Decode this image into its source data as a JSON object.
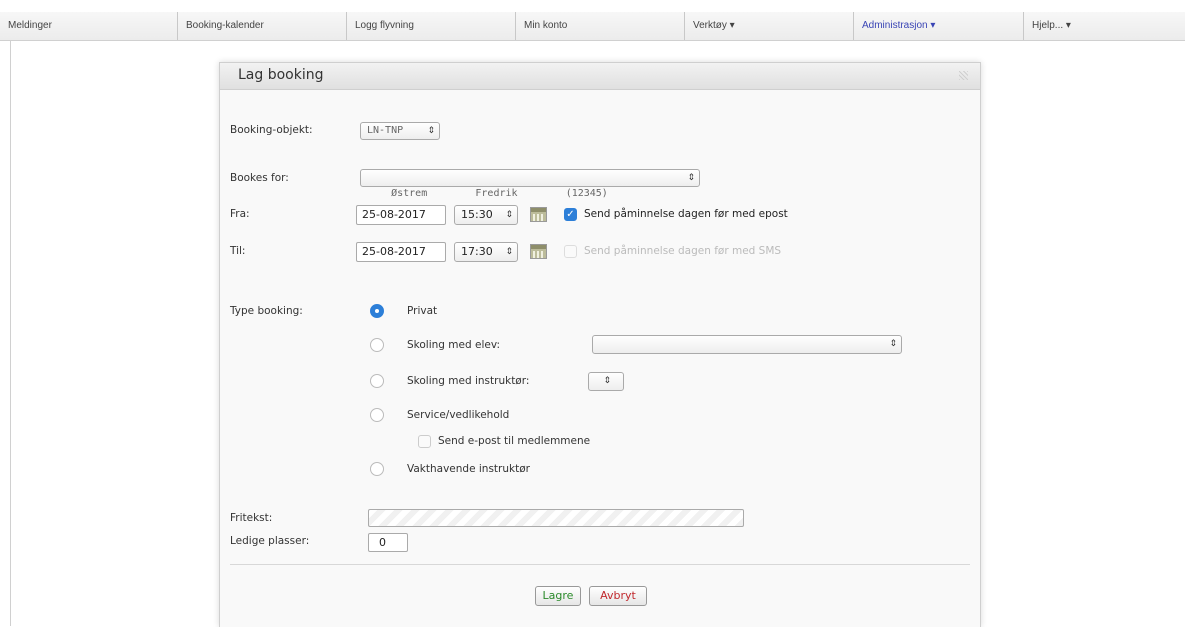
{
  "nav": [
    {
      "label": "Meldinger"
    },
    {
      "label": "Booking-kalender"
    },
    {
      "label": "Logg flyvning"
    },
    {
      "label": "Min konto"
    },
    {
      "label": "Verktøy ▾"
    },
    {
      "label": "Administrasjon ▾"
    },
    {
      "label": "Hjelp... ▾"
    }
  ],
  "dialog": {
    "title": "Lag booking",
    "booking_object_label": "Booking-objekt:",
    "booking_object_value": "LN-TNP",
    "booked_for_label": "Bookes for:",
    "booked_for_value": "Østrem        Fredrik        (12345)",
    "from_label": "Fra:",
    "from_date": "25-08-2017",
    "from_time": "15:30",
    "to_label": "Til:",
    "to_date": "25-08-2017",
    "to_time": "17:30",
    "remind_email_label": "Send påminnelse dagen før med epost",
    "remind_sms_label": "Send påminnelse dagen før med SMS",
    "type_label": "Type booking:",
    "type_options": {
      "private": "Privat",
      "student": "Skoling med elev:",
      "instructor": "Skoling med instruktør:",
      "service": "Service/vedlikehold",
      "notify_members": "Send e-post til medlemmene",
      "duty": "Vakthavende instruktør"
    },
    "freetext_label": "Fritekst:",
    "freetext_value": "",
    "seats_label": "Ledige plasser:",
    "seats_value": "0",
    "save_label": "Lagre",
    "cancel_label": "Avbryt"
  },
  "colors": {
    "accent": "#2d7fd8",
    "admin_link": "#3a45b5",
    "save_text": "#2a8a2a",
    "cancel_text": "#c0282d"
  }
}
